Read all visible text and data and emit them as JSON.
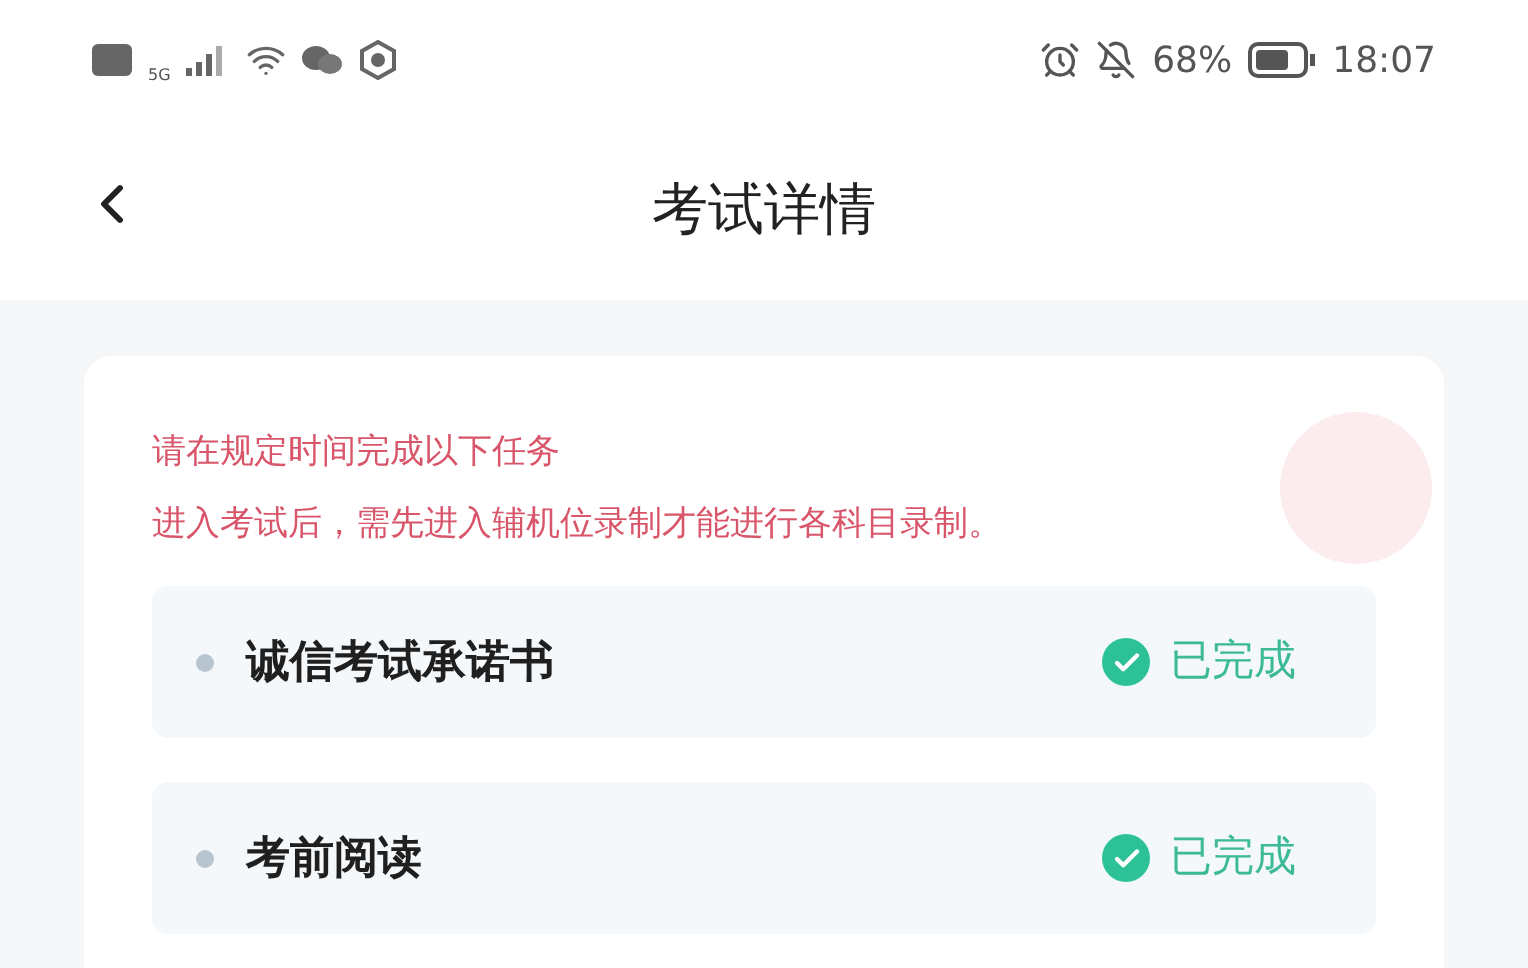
{
  "status_bar": {
    "network": "5G",
    "battery": "68%",
    "time": "18:07"
  },
  "nav": {
    "title": "考试详情"
  },
  "notice": [
    "请在规定时间完成以下任务",
    "进入考试后，需先进入辅机位录制才能进行各科目录制。"
  ],
  "tasks": [
    {
      "title": "诚信考试承诺书",
      "status": "已完成",
      "completed": true
    },
    {
      "title": "考前阅读",
      "status": "已完成",
      "completed": true
    }
  ]
}
